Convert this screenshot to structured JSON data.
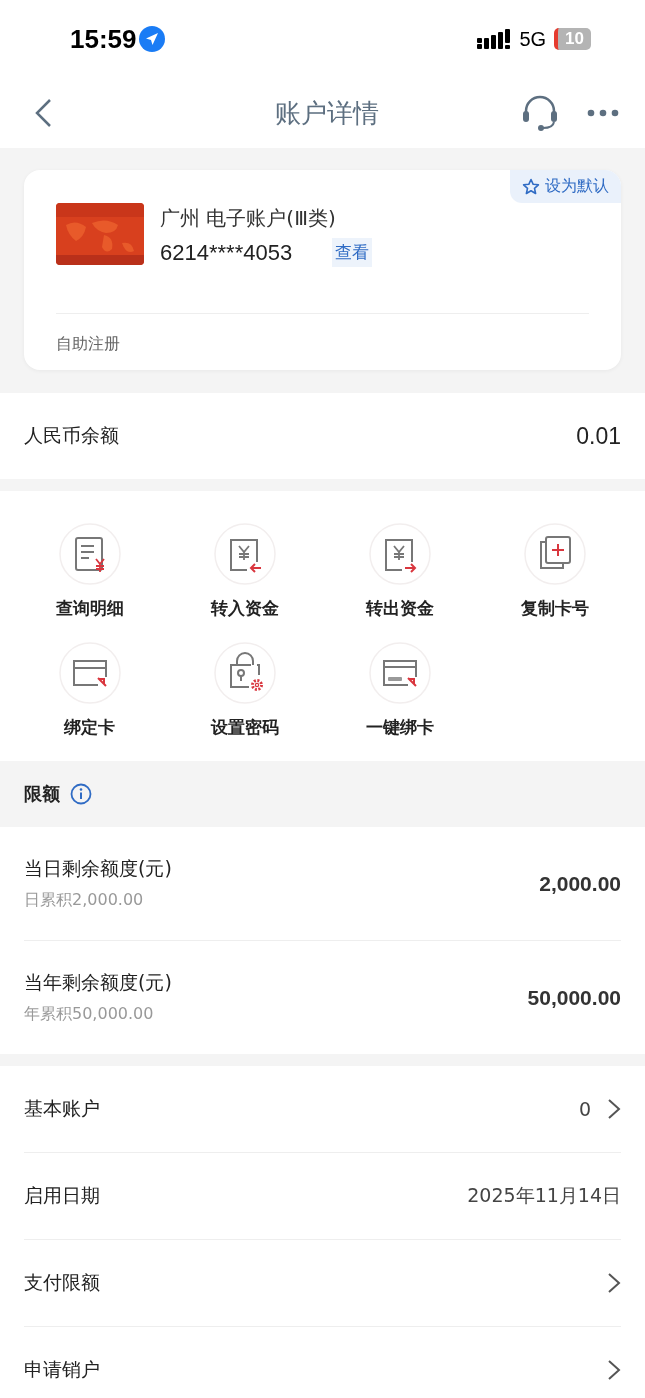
{
  "status_bar": {
    "time": "15:59",
    "network": "5G",
    "battery": "10"
  },
  "nav": {
    "title": "账户详情"
  },
  "account_card": {
    "default_button": "设为默认",
    "name": "广州 电子账户(Ⅲ类)",
    "number": "6214****4053",
    "view_button": "查看",
    "footer": "自助注册"
  },
  "balance": {
    "label": "人民币余额",
    "value": "0.01"
  },
  "actions": [
    {
      "label": "查询明细",
      "kind": "statement"
    },
    {
      "label": "转入资金",
      "kind": "transfer-in"
    },
    {
      "label": "转出资金",
      "kind": "transfer-out"
    },
    {
      "label": "复制卡号",
      "kind": "copy"
    },
    {
      "label": "绑定卡",
      "kind": "bind"
    },
    {
      "label": "设置密码",
      "kind": "password"
    },
    {
      "label": "一键绑卡",
      "kind": "pay"
    }
  ],
  "limits": {
    "title": "限额",
    "rows": [
      {
        "label": "当日剩余额度(元)",
        "sub": "日累积2,000.00",
        "value": "2,000.00"
      },
      {
        "label": "当年剩余额度(元)",
        "sub": "年累积50,000.00",
        "value": "50,000.00"
      }
    ]
  },
  "settings": [
    {
      "label": "基本账户",
      "value": "0",
      "chevron": true
    },
    {
      "label": "启用日期",
      "value": "2025年11月14日",
      "chevron": false
    },
    {
      "label": "支付限额",
      "chevron": true
    },
    {
      "label": "申请销户",
      "chevron": true
    }
  ]
}
